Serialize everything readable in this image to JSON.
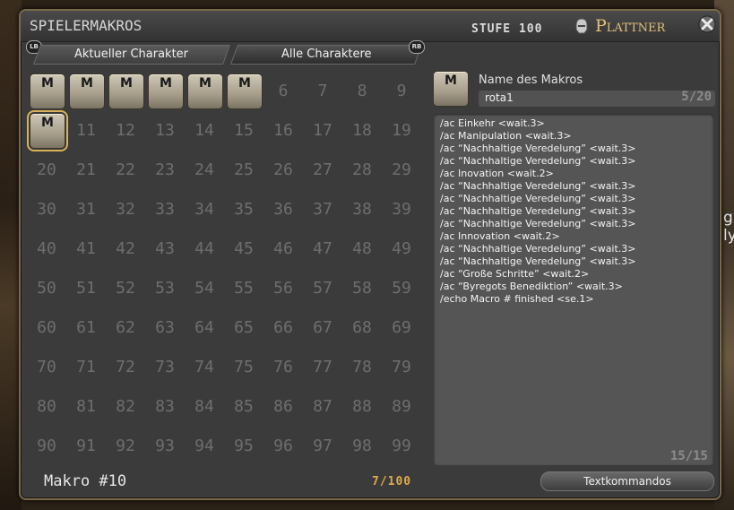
{
  "window": {
    "title": "SPIELERMAKROS",
    "level_label": "STUFE 100",
    "job_name": "Plattner",
    "job_icon": "helmet-icon",
    "close_icon": "close-icon"
  },
  "tabs": [
    {
      "label": "Aktueller Charakter",
      "active": false
    },
    {
      "label": "Alle Charaktere",
      "active": true
    }
  ],
  "tab_hints": {
    "left": "LB",
    "right": "RB"
  },
  "macro_grid": {
    "filled_icon_glyph": "M",
    "filled": [
      0,
      1,
      2,
      3,
      4,
      5,
      10
    ],
    "selected": 10,
    "numbers": [
      "",
      "",
      "",
      "",
      "",
      "",
      "6",
      "7",
      "8",
      "9",
      "",
      "11",
      "12",
      "13",
      "14",
      "15",
      "16",
      "17",
      "18",
      "19",
      "20",
      "21",
      "22",
      "23",
      "24",
      "25",
      "26",
      "27",
      "28",
      "29",
      "30",
      "31",
      "32",
      "33",
      "34",
      "35",
      "36",
      "37",
      "38",
      "39",
      "40",
      "41",
      "42",
      "43",
      "44",
      "45",
      "46",
      "47",
      "48",
      "49",
      "50",
      "51",
      "52",
      "53",
      "54",
      "55",
      "56",
      "57",
      "58",
      "59",
      "60",
      "61",
      "62",
      "63",
      "64",
      "65",
      "66",
      "67",
      "68",
      "69",
      "70",
      "71",
      "72",
      "73",
      "74",
      "75",
      "76",
      "77",
      "78",
      "79",
      "80",
      "81",
      "82",
      "83",
      "84",
      "85",
      "86",
      "87",
      "88",
      "89",
      "90",
      "91",
      "92",
      "93",
      "94",
      "95",
      "96",
      "97",
      "98",
      "99"
    ]
  },
  "macro_editor": {
    "icon_glyph": "M",
    "name_label": "Name des Makros",
    "name_value": "rota1",
    "name_count": "5/20",
    "lines": [
      "/ac Einkehr <wait.3>",
      "/ac Manipulation <wait.3>",
      "/ac “Nachhaltige Veredelung” <wait.3>",
      "/ac “Nachhaltige Veredelung” <wait.3>",
      "/ac Inovation <wait.2>",
      "/ac “Nachhaltige Veredelung” <wait.3>",
      "/ac “Nachhaltige Veredelung” <wait.3>",
      "/ac “Nachhaltige Veredelung” <wait.3>",
      "/ac “Nachhaltige Veredelung” <wait.3>",
      "/ac Innovation <wait.2>",
      "/ac “Nachhaltige Veredelung” <wait.3>",
      "/ac “Nachhaltige Veredelung” <wait.3>",
      "/ac “Große Schritte” <wait.2>",
      "/ac “Byregots Benediktion” <wait.3>",
      "/echo Macro # finished <se.1>"
    ],
    "line_count": "15/15"
  },
  "footer": {
    "makro_label": "Makro #10",
    "macro_count": "7/100",
    "textcmd_button": "Textkommandos"
  },
  "background": {
    "right_glyphs": "g\nly"
  }
}
